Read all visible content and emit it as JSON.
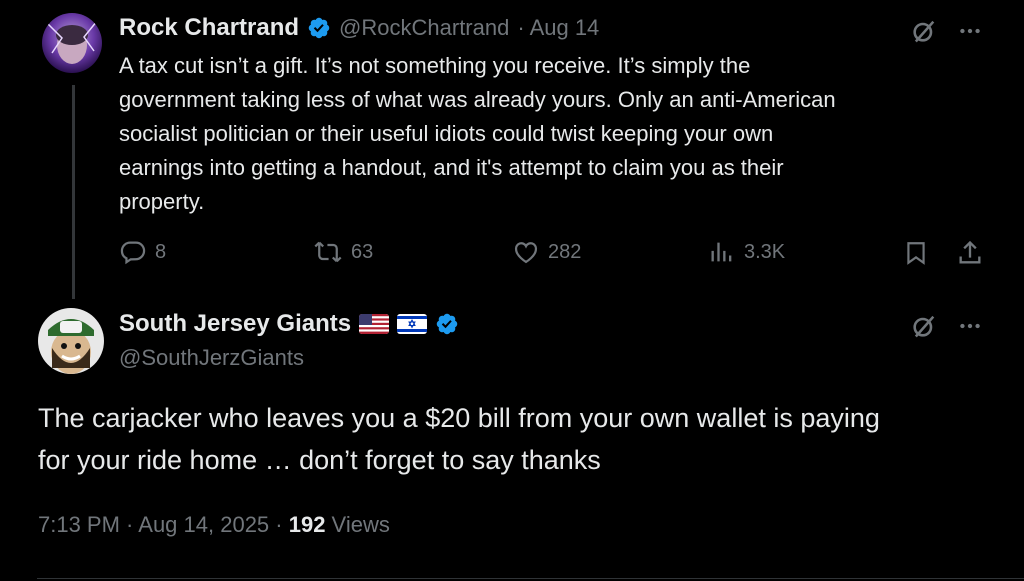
{
  "tweet1": {
    "author_name": "Rock Chartrand",
    "handle": "@RockChartrand",
    "date": "· Aug 14",
    "text_lines": [
      "A tax cut isn’t a gift. It’s not something you receive. It’s simply the",
      "government taking less of what was already yours. Only an anti-American",
      "socialist politician or their useful idiots could twist keeping your own",
      "earnings into getting a handout, and it's attempt to claim you as their",
      "property."
    ],
    "replies": "8",
    "reposts": "63",
    "likes": "282",
    "views": "3.3K"
  },
  "tweet2": {
    "author_name": "South Jersey Giants",
    "handle": "@SouthJerzGiants",
    "text_lines": [
      "The carjacker who leaves you a $20 bill from your own wallet is paying",
      "for your ride home … don’t forget to say thanks"
    ],
    "timestamp": "7:13 PM · Aug 14, 2025 · ",
    "views_count": "192",
    "views_label": " Views"
  },
  "colors": {
    "background": "#000000",
    "text": "#e7e9ea",
    "muted": "#71767b",
    "verified": "#1d9bf0"
  },
  "icons": [
    "grok-icon",
    "more-icon",
    "reply-icon",
    "repost-icon",
    "like-icon",
    "views-icon",
    "bookmark-icon",
    "share-icon",
    "verified-icon"
  ]
}
